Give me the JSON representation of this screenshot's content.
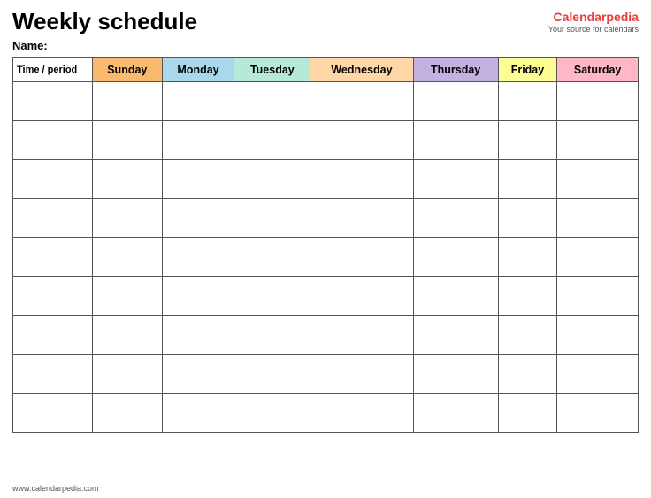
{
  "title": "Weekly schedule",
  "name_label": "Name:",
  "logo": {
    "main_text": "Calendar",
    "main_accent": "pedia",
    "sub_text": "Your source for calendars"
  },
  "table": {
    "headers": [
      {
        "key": "time",
        "label": "Time / period",
        "class": "time-header"
      },
      {
        "key": "sunday",
        "label": "Sunday",
        "class": "sunday"
      },
      {
        "key": "monday",
        "label": "Monday",
        "class": "monday"
      },
      {
        "key": "tuesday",
        "label": "Tuesday",
        "class": "tuesday"
      },
      {
        "key": "wednesday",
        "label": "Wednesday",
        "class": "wednesday"
      },
      {
        "key": "thursday",
        "label": "Thursday",
        "class": "thursday"
      },
      {
        "key": "friday",
        "label": "Friday",
        "class": "friday"
      },
      {
        "key": "saturday",
        "label": "Saturday",
        "class": "saturday"
      }
    ],
    "row_count": 9
  },
  "footer": {
    "url": "www.calendarpedia.com"
  }
}
